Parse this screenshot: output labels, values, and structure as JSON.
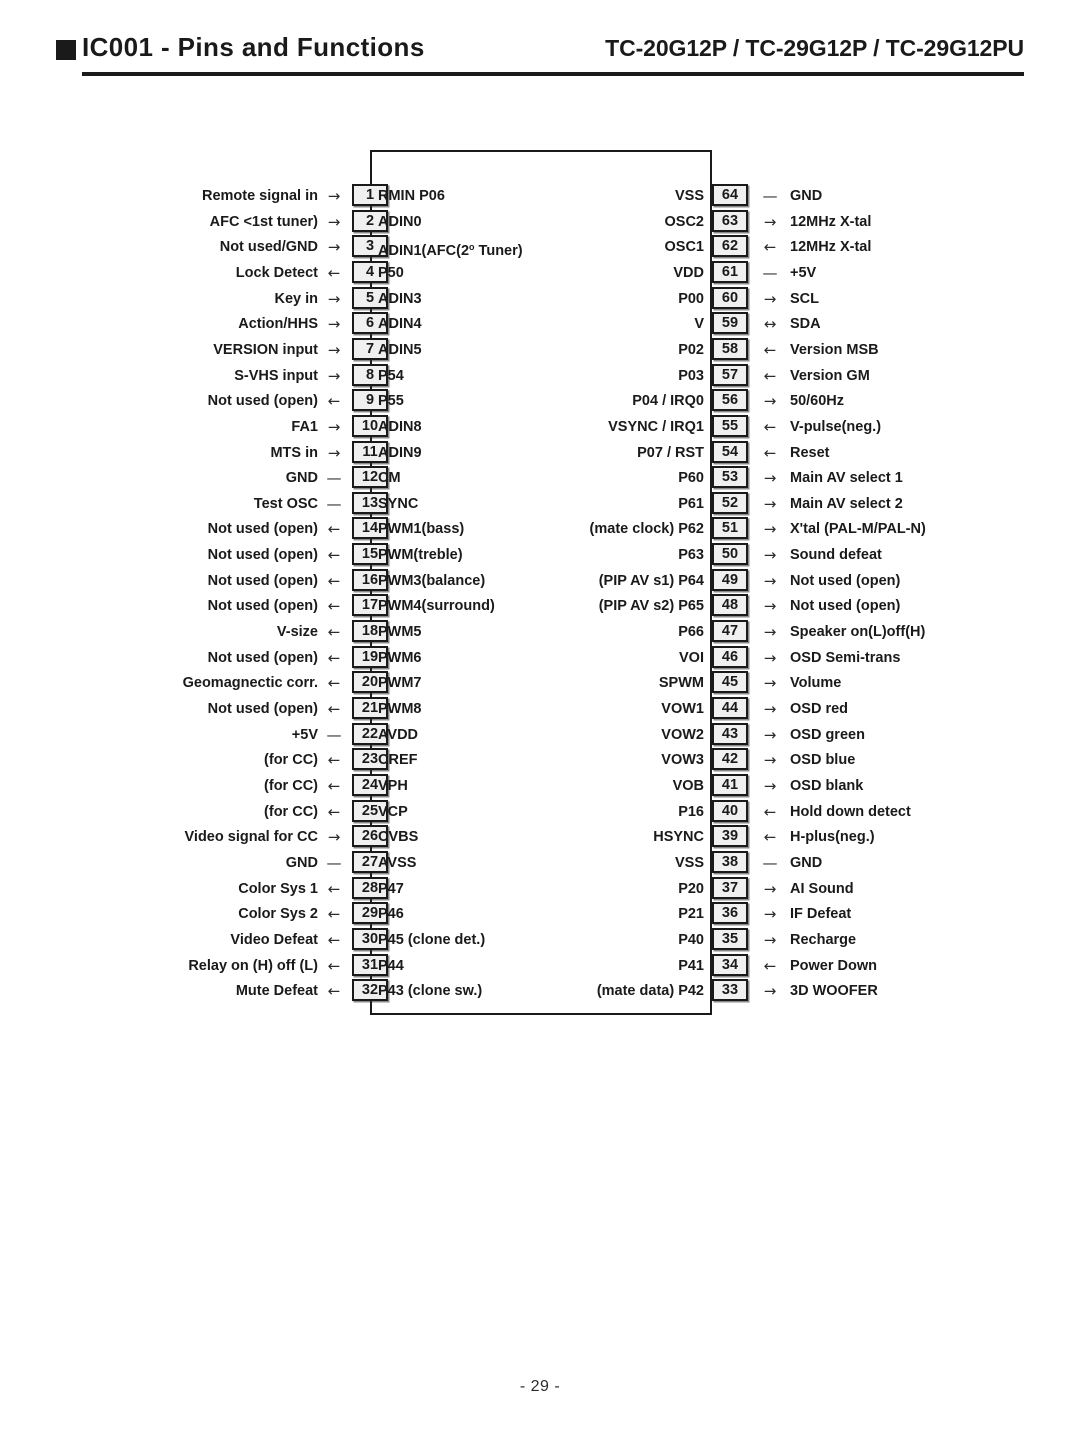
{
  "header": {
    "title": "IC001 - Pins and Functions",
    "models": "TC-20G12P / TC-29G12P / TC-29G12PU",
    "bullet": "black-square"
  },
  "footer": {
    "page": "- 29 -"
  },
  "colors": {
    "text": "#1a1a1a",
    "pin_box_fill": "#f0f0f0",
    "pin_box_border": "#1a1a1a",
    "page_background": "#ffffff"
  },
  "diagram": {
    "type": "ic-pinout",
    "component": "IC001",
    "total_pins": 64,
    "arrow_legend": {
      "in": "→",
      "out": "←",
      "bidirectional": "↔",
      "none": "—"
    },
    "left_pins": [
      {
        "num": "1",
        "signal": "RMIN P06",
        "arrow": "→",
        "label": "Remote signal in"
      },
      {
        "num": "2",
        "signal": "ADIN0",
        "arrow": "→",
        "label": "AFC <1st tuner)"
      },
      {
        "num": "3",
        "signal": "ADIN1(AFC(2º Tuner)",
        "arrow": "→",
        "label": "Not used/GND"
      },
      {
        "num": "4",
        "signal": "P50",
        "arrow": "←",
        "label": "Lock Detect"
      },
      {
        "num": "5",
        "signal": "ADIN3",
        "arrow": "→",
        "label": "Key in"
      },
      {
        "num": "6",
        "signal": "ADIN4",
        "arrow": "→",
        "label": "Action/HHS"
      },
      {
        "num": "7",
        "signal": "ADIN5",
        "arrow": "→",
        "label": "VERSION  input"
      },
      {
        "num": "8",
        "signal": "P54",
        "arrow": "→",
        "label": "S-VHS input"
      },
      {
        "num": "9",
        "signal": "P55",
        "arrow": "←",
        "label": "Not used (open)"
      },
      {
        "num": "10",
        "signal": "ADIN8",
        "arrow": "→",
        "label": "FA1"
      },
      {
        "num": "11",
        "signal": "ADIN9",
        "arrow": "→",
        "label": "MTS in"
      },
      {
        "num": "12",
        "signal": "CM",
        "arrow": "—",
        "label": "GND"
      },
      {
        "num": "13",
        "signal": "SYNC",
        "arrow": "—",
        "label": "Test OSC"
      },
      {
        "num": "14",
        "signal": "PWM1(bass)",
        "arrow": "←",
        "label": "Not used (open)"
      },
      {
        "num": "15",
        "signal": "PWM(treble)",
        "arrow": "←",
        "label": "Not used (open)"
      },
      {
        "num": "16",
        "signal": "PWM3(balance)",
        "arrow": "←",
        "label": "Not used (open)"
      },
      {
        "num": "17",
        "signal": "PWM4(surround)",
        "arrow": "←",
        "label": "Not used (open)"
      },
      {
        "num": "18",
        "signal": "PWM5",
        "arrow": "←",
        "label": "V-size"
      },
      {
        "num": "19",
        "signal": "PWM6",
        "arrow": "←",
        "label": "Not used (open)"
      },
      {
        "num": "20",
        "signal": "PWM7",
        "arrow": "←",
        "label": "Geomagnectic corr."
      },
      {
        "num": "21",
        "signal": "PWM8",
        "arrow": "←",
        "label": "Not used (open)"
      },
      {
        "num": "22",
        "signal": "AVDD",
        "arrow": "—",
        "label": "+5V"
      },
      {
        "num": "23",
        "signal": "CREF",
        "arrow": "←",
        "label": "(for CC)"
      },
      {
        "num": "24",
        "signal": "VPH",
        "arrow": "←",
        "label": "(for CC)"
      },
      {
        "num": "25",
        "signal": "VCP",
        "arrow": "←",
        "label": "(for CC)"
      },
      {
        "num": "26",
        "signal": "CVBS",
        "arrow": "→",
        "label": "Video signal for CC"
      },
      {
        "num": "27",
        "signal": "AVSS",
        "arrow": "—",
        "label": "GND"
      },
      {
        "num": "28",
        "signal": "P47",
        "arrow": "←",
        "label": "Color Sys 1"
      },
      {
        "num": "29",
        "signal": "P46",
        "arrow": "←",
        "label": "Color Sys 2"
      },
      {
        "num": "30",
        "signal": "P45 (clone det.)",
        "arrow": "←",
        "label": "Video Defeat"
      },
      {
        "num": "31",
        "signal": "P44",
        "arrow": "←",
        "label": "Relay on (H) off (L)"
      },
      {
        "num": "32",
        "signal": "P43 (clone sw.)",
        "arrow": "←",
        "label": "Mute Defeat"
      }
    ],
    "right_pins": [
      {
        "num": "64",
        "signal": "VSS",
        "arrow": "—",
        "label": "GND"
      },
      {
        "num": "63",
        "signal": "OSC2",
        "arrow": "→",
        "label": "12MHz X-tal"
      },
      {
        "num": "62",
        "signal": "OSC1",
        "arrow": "←",
        "label": "12MHz X-tal"
      },
      {
        "num": "61",
        "signal": "VDD",
        "arrow": "—",
        "label": "+5V"
      },
      {
        "num": "60",
        "signal": "P00",
        "arrow": "→",
        "label": "SCL"
      },
      {
        "num": "59",
        "signal": "V",
        "arrow": "↔",
        "label": "SDA"
      },
      {
        "num": "58",
        "signal": "P02",
        "arrow": "←",
        "label": "Version MSB"
      },
      {
        "num": "57",
        "signal": "P03",
        "arrow": "←",
        "label": "Version GM"
      },
      {
        "num": "56",
        "signal": "P04 / IRQ0",
        "arrow": "→",
        "label": "50/60Hz"
      },
      {
        "num": "55",
        "signal": "VSYNC / IRQ1",
        "arrow": "←",
        "label": "V-pulse(neg.)"
      },
      {
        "num": "54",
        "signal": "P07 / RST",
        "arrow": "←",
        "label": "Reset"
      },
      {
        "num": "53",
        "signal": "P60",
        "arrow": "→",
        "label": "Main AV select 1"
      },
      {
        "num": "52",
        "signal": "P61",
        "arrow": "→",
        "label": "Main AV select 2"
      },
      {
        "num": "51",
        "signal": "(mate clock) P62",
        "arrow": "→",
        "label": "X'tal (PAL-M/PAL-N)"
      },
      {
        "num": "50",
        "signal": "P63",
        "arrow": "→",
        "label": "Sound defeat"
      },
      {
        "num": "49",
        "signal": "(PIP AV s1) P64",
        "arrow": "→",
        "label": "Not used (open)"
      },
      {
        "num": "48",
        "signal": "(PIP AV s2) P65",
        "arrow": "→",
        "label": "Not used (open)"
      },
      {
        "num": "47",
        "signal": "P66",
        "arrow": "→",
        "label": "Speaker on(L)off(H)"
      },
      {
        "num": "46",
        "signal": "VOI",
        "arrow": "→",
        "label": "OSD Semi-trans"
      },
      {
        "num": "45",
        "signal": "SPWM",
        "arrow": "→",
        "label": "Volume"
      },
      {
        "num": "44",
        "signal": "VOW1",
        "arrow": "→",
        "label": "OSD red"
      },
      {
        "num": "43",
        "signal": "VOW2",
        "arrow": "→",
        "label": "OSD green"
      },
      {
        "num": "42",
        "signal": "VOW3",
        "arrow": "→",
        "label": "OSD blue"
      },
      {
        "num": "41",
        "signal": "VOB",
        "arrow": "→",
        "label": "OSD blank"
      },
      {
        "num": "40",
        "signal": "P16",
        "arrow": "←",
        "label": "Hold down detect"
      },
      {
        "num": "39",
        "signal": "HSYNC",
        "arrow": "←",
        "label": "H-plus(neg.)"
      },
      {
        "num": "38",
        "signal": "VSS",
        "arrow": "—",
        "label": "GND"
      },
      {
        "num": "37",
        "signal": "P20",
        "arrow": "→",
        "label": "AI Sound"
      },
      {
        "num": "36",
        "signal": "P21",
        "arrow": "→",
        "label": "IF Defeat"
      },
      {
        "num": "35",
        "signal": "P40",
        "arrow": "→",
        "label": "Recharge"
      },
      {
        "num": "34",
        "signal": "P41",
        "arrow": "←",
        "label": "Power Down"
      },
      {
        "num": "33",
        "signal": "(mate data) P42",
        "arrow": "→",
        "label": "3D WOOFER"
      }
    ]
  }
}
